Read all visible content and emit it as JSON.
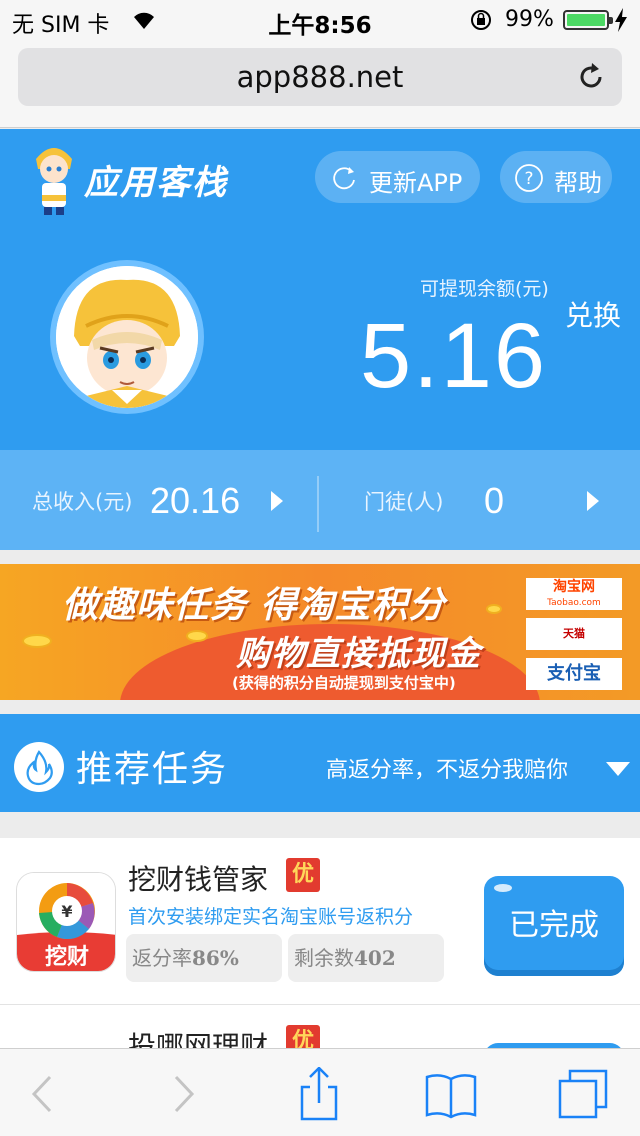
{
  "status_bar": {
    "carrier": "无 SIM 卡",
    "time": "上午8:56",
    "battery_pct": "99%",
    "battery_level": 0.99,
    "battery_color": "#4cd964"
  },
  "browser": {
    "url": "app888.net",
    "reload_icon": "reload-icon"
  },
  "header": {
    "logo_text": "应用客栈",
    "update_label": "更新APP",
    "help_label": "帮助",
    "bg_color": "#2f9cf0"
  },
  "balance": {
    "label": "可提现余额(元)",
    "value": "5.16",
    "exchange_label": "兑换"
  },
  "stats": {
    "income_label": "总收入(元)",
    "income_value": "20.16",
    "apprentice_label": "门徒(人)",
    "apprentice_value": "0"
  },
  "banner": {
    "line1": "做趣味任务 得淘宝积分",
    "line2": "购物直接抵现金",
    "line3": "(获得的积分自动提现到支付宝中)",
    "partner_taobao": "淘宝网",
    "partner_taobao_sub": "Taobao.com",
    "partner_tmall": "天猫 TMALL.COM",
    "partner_alipay": "支付宝"
  },
  "recommend": {
    "title": "推荐任务",
    "subtitle": "高返分率，不返分我赔你"
  },
  "tasks": [
    {
      "name": "挖财钱管家",
      "badge": "优",
      "desc": "首次安装绑定实名淘宝账号返积分",
      "rate_label": "返分率",
      "rate_value": "86%",
      "remain_label": "剩余数",
      "remain_value": "402",
      "icon_text": "挖财",
      "button": "已完成"
    },
    {
      "name": "投哪网理财",
      "badge": "优",
      "button": ""
    }
  ],
  "toolbar": {
    "back": "back-icon",
    "forward": "forward-icon",
    "share": "share-icon",
    "bookmarks": "bookmarks-icon",
    "tabs": "tabs-icon"
  }
}
